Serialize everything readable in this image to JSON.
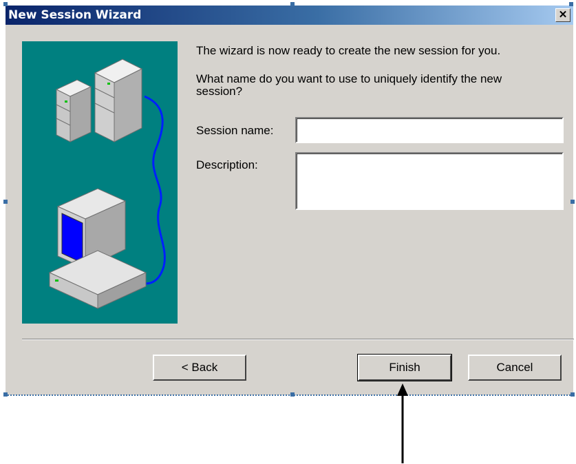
{
  "window": {
    "title": "New Session Wizard",
    "close_icon": "close-icon"
  },
  "intro": {
    "line1": "The wizard is now ready to create the new session for you.",
    "question": "What name do you want to use to uniquely identify the new session?"
  },
  "form": {
    "session_name_label": "Session name:",
    "session_name_value": "",
    "description_label": "Description:",
    "description_value": ""
  },
  "buttons": {
    "back": "< Back",
    "finish": "Finish",
    "cancel": "Cancel"
  },
  "colors": {
    "illustration_bg": "#008080",
    "dialog_bg": "#d6d3ce",
    "title_bar": "#0a246a"
  }
}
